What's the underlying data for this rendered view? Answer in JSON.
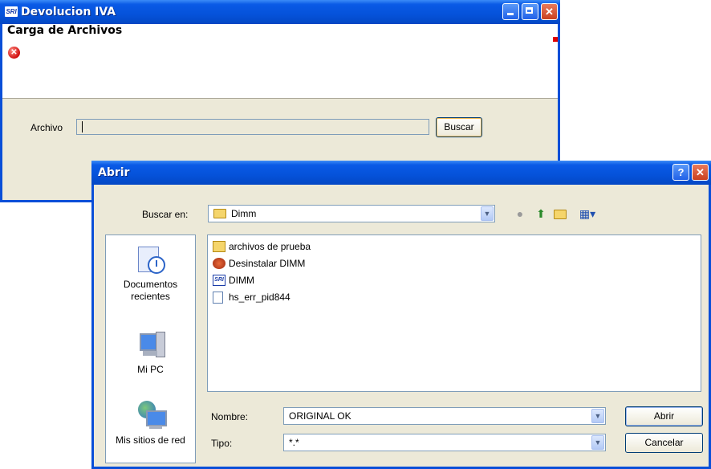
{
  "back_window": {
    "logo": "SRI",
    "title": "Devolucion IVA",
    "header_title": "Carga de Archivos",
    "error_icon_glyph": "✕",
    "archivo_label": "Archivo",
    "archivo_value": "",
    "buscar_label": "Buscar"
  },
  "dialog": {
    "title": "Abrir",
    "help_glyph": "?",
    "close_glyph": "✕",
    "look_in_label": "Buscar en:",
    "look_in_value": "Dimm",
    "places": [
      {
        "label_line1": "Documentos",
        "label_line2": "recientes",
        "icon": "recent-documents-icon"
      },
      {
        "label_line1": "Mi PC",
        "label_line2": "",
        "icon": "my-computer-icon"
      },
      {
        "label_line1": "Mis sitios de red",
        "label_line2": "",
        "icon": "network-places-icon"
      }
    ],
    "files": [
      {
        "name": "archivos de prueba",
        "icon": "folder-icon"
      },
      {
        "name": "Desinstalar DIMM",
        "icon": "uninstall-icon"
      },
      {
        "name": "DIMM",
        "icon": "sri-app-icon"
      },
      {
        "name": "hs_err_pid844",
        "icon": "text-file-icon"
      }
    ],
    "nombre_label": "Nombre:",
    "nombre_value": "ORIGINAL OK",
    "tipo_label": "Tipo:",
    "tipo_value": "*.*",
    "open_label": "Abrir",
    "cancel_label": "Cancelar"
  },
  "colors": {
    "titlebar": "#0552da",
    "window_face": "#ece9d8",
    "field_border": "#7f9db9"
  }
}
